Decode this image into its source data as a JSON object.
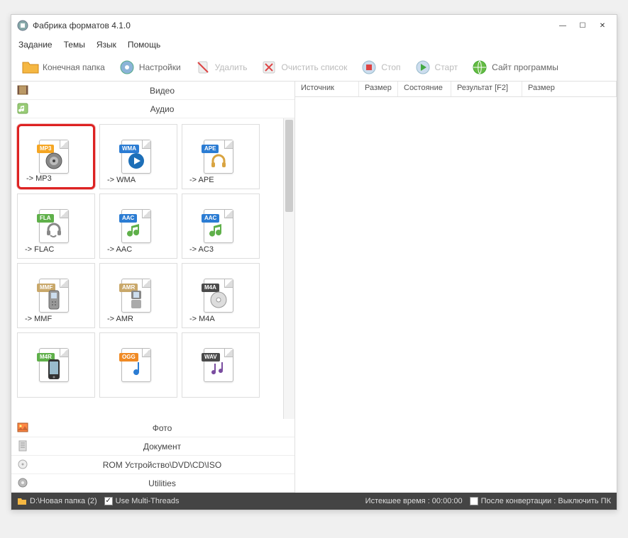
{
  "window": {
    "title": "Фабрика форматов 4.1.0"
  },
  "menu": {
    "items": [
      "Задание",
      "Темы",
      "Язык",
      "Помощь"
    ]
  },
  "toolbar": {
    "output_folder": "Конечная папка",
    "settings": "Настройки",
    "delete": "Удалить",
    "clear_list": "Очистить список",
    "stop": "Стоп",
    "start": "Старт",
    "site": "Сайт программы"
  },
  "categories": {
    "video": "Видео",
    "audio": "Аудио",
    "photo": "Фото",
    "document": "Документ",
    "rom": "ROM Устройство\\DVD\\CD\\ISO",
    "utilities": "Utilities"
  },
  "formats": [
    {
      "tag": "MP3",
      "tag_color": "#f5a623",
      "label": "-> MP3",
      "glyph": "speaker",
      "selected": true
    },
    {
      "tag": "WMA",
      "tag_color": "#2b7cd3",
      "label": "-> WMA",
      "glyph": "wmp"
    },
    {
      "tag": "APE",
      "tag_color": "#2b7cd3",
      "label": "-> APE",
      "glyph": "headphones"
    },
    {
      "tag": "FLA",
      "tag_color": "#5fb04a",
      "label": "-> FLAC",
      "glyph": "headset"
    },
    {
      "tag": "AAC",
      "tag_color": "#2b7cd3",
      "label": "-> AAC",
      "glyph": "note-green"
    },
    {
      "tag": "AAC",
      "tag_color": "#2b7cd3",
      "label": "-> AC3",
      "glyph": "note-green"
    },
    {
      "tag": "MMF",
      "tag_color": "#c9a86a",
      "label": "-> MMF",
      "glyph": "phone-old"
    },
    {
      "tag": "AMR",
      "tag_color": "#c9a86a",
      "label": "-> AMR",
      "glyph": "phone-flip"
    },
    {
      "tag": "M4A",
      "tag_color": "#4a4a4a",
      "label": "-> M4A",
      "glyph": "disc"
    },
    {
      "tag": "M4R",
      "tag_color": "#5fb04a",
      "label": "",
      "glyph": "iphone"
    },
    {
      "tag": "OGG",
      "tag_color": "#f08a24",
      "label": "",
      "glyph": "note-blue"
    },
    {
      "tag": "WAV",
      "tag_color": "#4a4a4a",
      "label": "",
      "glyph": "notes-purple"
    }
  ],
  "list_headers": {
    "source": "Источник",
    "size": "Размер",
    "state": "Состояние",
    "result": "Результат [F2]",
    "size2": "Размер"
  },
  "status": {
    "folder": "D:\\Новая папка (2)",
    "multithreads_label": "Use Multi-Threads",
    "multithreads_checked": true,
    "elapsed": "Истекшее время : 00:00:00",
    "after_label": "После конвертации : Выключить ПК",
    "after_checked": false
  }
}
